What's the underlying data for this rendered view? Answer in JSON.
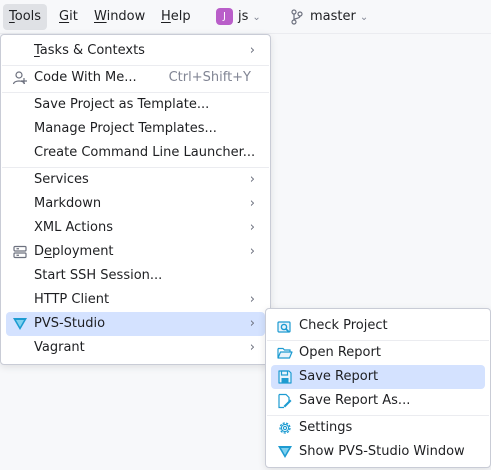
{
  "menubar": {
    "items": [
      {
        "label": "Tools",
        "mnemonic": "T",
        "rest": "ools"
      },
      {
        "label": "Git",
        "mnemonic": "G",
        "rest": "it"
      },
      {
        "label": "Window",
        "mnemonic": "W",
        "rest": "indow"
      },
      {
        "label": "Help",
        "mnemonic": "H",
        "rest": "elp"
      }
    ],
    "project": {
      "badge": "J",
      "name": "js"
    },
    "branch": {
      "name": "master"
    }
  },
  "tools_menu": {
    "tasks": {
      "mn": "T",
      "rest": "asks & Contexts"
    },
    "code_with_me": {
      "label": "Code With Me...",
      "shortcut": "Ctrl+Shift+Y"
    },
    "save_template": "Save Project as Template...",
    "manage_templates": "Manage Project Templates...",
    "cli_launcher": "Create Command Line Launcher...",
    "services": "Services",
    "markdown": "Markdown",
    "xml_actions": "XML Actions",
    "deployment": {
      "pre": "D",
      "mn": "e",
      "rest": "ployment"
    },
    "ssh": "Start SSH Session...",
    "http_client": "HTTP Client",
    "pvs_studio": "PVS-Studio",
    "vagrant": "Vagrant"
  },
  "pvs_menu": {
    "check_project": "Check Project",
    "open_report": "Open Report",
    "save_report": "Save Report",
    "save_report_as": "Save Report As...",
    "settings": "Settings",
    "show_window": "Show PVS-Studio Window"
  },
  "colors": {
    "selection": "#d4e2ff",
    "project_badge": "#b95ec9",
    "pvs_icon": "#1d9bd1",
    "active_menubar": "#dfe1e5"
  }
}
